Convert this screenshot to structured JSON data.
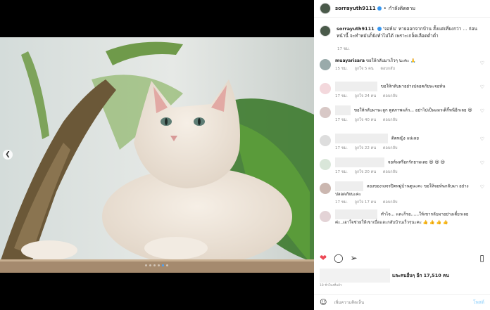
{
  "post": {
    "username": "sorrayuth9111",
    "follow_status": "กำลังติดตาม",
    "caption_user": "sorrayuth9111",
    "caption_text": "'จอห์น' หายออกจากบ้าน สั้งแต่เที่ยงกว่า ... ก่อนหน้านี้ จะทำหมันก็ยังทำไม่ได้ เพราะเกล็ดเลือดต่ำต่ำ",
    "caption_time": "17 ชม.",
    "likes_text": "และคนอื่นๆ อีก 17,510 คน",
    "date_text": "18 ชั่วโมงที่แล้ว",
    "add_comment_placeholder": "เพิ่มความคิดเห็น",
    "post_label": "โพสต์"
  },
  "comments": [
    {
      "user": "muayarisara",
      "text": "ขอให้กลับมาเร็วๆ นะคะ 🙏",
      "time": "15 ชม.",
      "likes": "ถูกใจ 5 คน",
      "reply": "ตอบกลับ"
    },
    {
      "user": "",
      "text": "ขอให้กลับมาอย่างปลอดภัยนะจอห์น",
      "time": "17 ชม.",
      "likes": "ถูกใจ 24 คน",
      "reply": "ตอบกลับ"
    },
    {
      "user": "",
      "text": "ขอให้กลับมานะลูก ดูสภาพแล้ว... อย่าไปเป็นแมวเด็กี้หนีอีกเลย 😢",
      "time": "17 ชม.",
      "likes": "ถูกใจ 40 คน",
      "reply": "ตอบกลับ"
    },
    {
      "user": "",
      "text": "ติดหญิง แน่เลย",
      "time": "17 ชม.",
      "likes": "ถูกใจ 22 คน",
      "reply": "ตอบกลับ"
    },
    {
      "user": "",
      "text": "จอห์นหรือกรักยามเลย 😢 😢 😢",
      "time": "17 ชม.",
      "likes": "ถูกใจ 20 คน",
      "reply": "ตอบกลับ"
    },
    {
      "user": "",
      "text": "ลองของวงจรปิดหมู่บ้านดูนะคะ ขอให้จอห์นกลับมา อย่างปลอดภัยนะคะ",
      "time": "17 ชม.",
      "likes": "ถูกใจ 17 คน",
      "reply": "ตอบกลับ"
    },
    {
      "user": "",
      "text": "ทำไจ... และก็รอ......ให้เขากลับมาอย่างเดี๋ยวเลย ค่ะ..เอาใจช่วยให้เขาเบื่อและกลับบ้านเร็วๆนะคะ 👍 👍 👍 👍",
      "time": "17 ชม.",
      "likes": "",
      "reply": ""
    }
  ],
  "icons": {
    "heart": "heart-icon",
    "comment": "comment-icon",
    "share": "share-icon",
    "save": "bookmark-icon",
    "prev": "chevron-left-icon",
    "emoji": "emoji-icon"
  },
  "colors": {
    "like": "#ed4956",
    "verified": "#3897f0",
    "muted": "#8e8e8e"
  },
  "carousel": {
    "count": 6,
    "active": 5
  }
}
